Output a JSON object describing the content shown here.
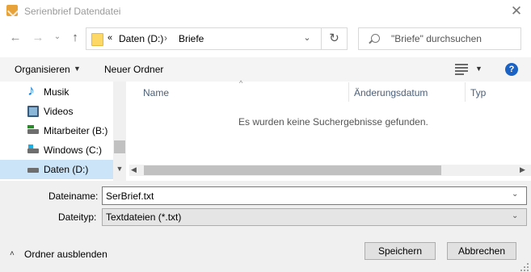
{
  "window": {
    "title": "Serienbrief Datendatei",
    "close_label": "✕"
  },
  "nav": {
    "back": "←",
    "forward": "→",
    "recent": "⌄",
    "up": "↑",
    "refresh": "↻"
  },
  "address": {
    "more": "«",
    "segments": [
      "Daten (D:)",
      "Briefe"
    ],
    "separator": "›",
    "dropdown": "⌄"
  },
  "search": {
    "placeholder": "\"Briefe\" durchsuchen"
  },
  "toolbar": {
    "organize": "Organisieren",
    "organize_caret": "▼",
    "new_folder": "Neuer Ordner",
    "view_caret": "▼",
    "help": "?"
  },
  "sidebar": {
    "items": [
      {
        "label": "Musik",
        "icon": "music-icon"
      },
      {
        "label": "Videos",
        "icon": "video-icon"
      },
      {
        "label": "Mitarbeiter (B:)",
        "icon": "network-drive-icon"
      },
      {
        "label": "Windows (C:)",
        "icon": "windows-drive-icon"
      },
      {
        "label": "Daten (D:)",
        "icon": "drive-icon",
        "selected": true
      }
    ]
  },
  "filelist": {
    "sort_caret": "^",
    "columns": [
      "Name",
      "Änderungsdatum",
      "Typ"
    ],
    "empty_message": "Es wurden keine Suchergebnisse gefunden."
  },
  "form": {
    "filename_label": "Dateiname:",
    "filename_value": "SerBrief.txt",
    "filetype_label": "Dateityp:",
    "filetype_value": "Textdateien (*.txt)"
  },
  "footer": {
    "hide_folders": "Ordner ausblenden",
    "save": "Speichern",
    "cancel": "Abbrechen"
  },
  "colors": {
    "accent": "#0078d7",
    "selection": "#cce4f7",
    "help": "#1a63c4",
    "folder": "#fdd866"
  }
}
